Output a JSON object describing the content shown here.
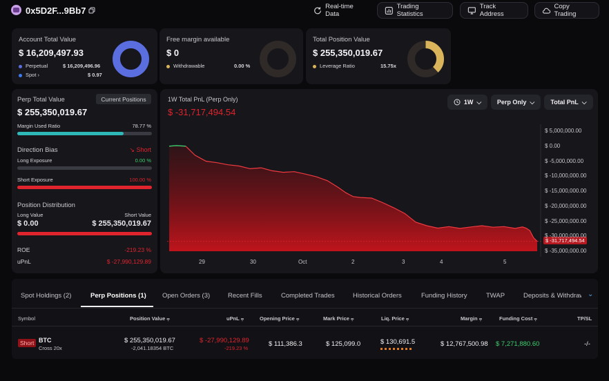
{
  "header": {
    "address": "0x5D2F...9Bb7",
    "buttons": [
      "Real-time Data",
      "Trading Statistics",
      "Track Address",
      "Copy Trading"
    ]
  },
  "account": {
    "title": "Account Total Value",
    "value": "$ 16,209,497.93",
    "perpetual_label": "Perpetual",
    "perpetual_value": "$ 16,209,496.96",
    "spot_label": "Spot",
    "spot_value": "$ 0.97",
    "donut_perp_fraction": 0.9999
  },
  "margin": {
    "title": "Free margin available",
    "value": "$ 0",
    "withdrawable_label": "Withdrawable",
    "withdrawable_value": "0.00 %"
  },
  "position": {
    "title": "Total Position Value",
    "value": "$ 255,350,019.67",
    "leverage_label": "Leverage Ratio",
    "leverage_value": "15.75x",
    "donut_fraction": 0.38
  },
  "perp": {
    "title": "Perp Total Value",
    "current_positions_label": "Current Positions",
    "value": "$ 255,350,019.67",
    "margin_used_label": "Margin Used Ratio",
    "margin_used_value": "78.77 %",
    "margin_used_fraction": 0.7877,
    "direction_bias_label": "Direction Bias",
    "direction_bias_value": "Short",
    "long_exposure_label": "Long Exposure",
    "long_exposure_value": "0.00 %",
    "long_exposure_fraction": 0,
    "short_exposure_label": "Short Exposure",
    "short_exposure_value": "100.00 %",
    "short_exposure_fraction": 1,
    "distribution_label": "Position Distribution",
    "long_value_label": "Long Value",
    "short_value_label": "Short Value",
    "long_value": "$ 0.00",
    "short_value": "$ 255,350,019.67",
    "roe_label": "ROE",
    "roe_value": "-219.23 %",
    "upnl_label": "uPnL",
    "upnl_value": "$ -27,990,129.89"
  },
  "pnl_chart_card": {
    "title": "1W Total PnL (Perp Only)",
    "value": "$ -31,717,494.54",
    "controls": [
      "1W",
      "Perp Only",
      "Total PnL"
    ]
  },
  "chart_data": {
    "type": "area",
    "title": "1W Total PnL (Perp Only)",
    "x_ticks": [
      "29",
      "30",
      "Oct",
      "2",
      "3",
      "4",
      "5"
    ],
    "y_ticks": [
      "$ 5,000,000.00",
      "$ 0.00",
      "$ -5,000,000.00",
      "$ -10,000,000.00",
      "$ -15,000,000.00",
      "$ -20,000,000.00",
      "$ -25,000,000.00",
      "$ -30,000,000.00",
      "$ -35,000,000.00"
    ],
    "ylim": [
      -35000000,
      5000000
    ],
    "last_value_label": "$ -31,717,494.54",
    "last_value": -31717494.54,
    "x": [
      0,
      0.02,
      0.045,
      0.07,
      0.085,
      0.1,
      0.13,
      0.16,
      0.19,
      0.22,
      0.25,
      0.28,
      0.31,
      0.34,
      0.37,
      0.4,
      0.43,
      0.46,
      0.48,
      0.5,
      0.52,
      0.55,
      0.58,
      0.61,
      0.64,
      0.67,
      0.7,
      0.73,
      0.76,
      0.79,
      0.82,
      0.85,
      0.88,
      0.91,
      0.94,
      0.96,
      0.97,
      0.98,
      0.99,
      1
    ],
    "values": [
      0,
      200000,
      0,
      -3000000,
      -4000000,
      -5000000,
      -5500000,
      -6200000,
      -6600000,
      -7500000,
      -7200000,
      -8200000,
      -8700000,
      -8500000,
      -9300000,
      -10200000,
      -11500000,
      -13800000,
      -15500000,
      -16800000,
      -17100000,
      -17300000,
      -18800000,
      -20500000,
      -22400000,
      -25300000,
      -26500000,
      -27300000,
      -26800000,
      -27400000,
      -26900000,
      -26500000,
      -27000000,
      -26800000,
      -27400000,
      -26900000,
      -27300000,
      -28100000,
      -30500000,
      -31717494.54
    ],
    "grid": false
  },
  "tabs": [
    "Spot Holdings (2)",
    "Perp Positions (1)",
    "Open Orders (3)",
    "Recent Fills",
    "Completed Trades",
    "Historical Orders",
    "Funding History",
    "TWAP",
    "Deposits & Withdraw"
  ],
  "table": {
    "headers": [
      "Symbol",
      "Position Value",
      "uPnL",
      "Opening Price",
      "Mark Price",
      "Liq. Price",
      "Margin",
      "Funding Cost",
      "TP/SL"
    ],
    "row": {
      "side": "Short",
      "coin": "BTC",
      "mode": "Cross 20x",
      "position_value": "$ 255,350,019.67",
      "position_size": "-2,041.18354 BTC",
      "upnl": "$ -27,990,129.89",
      "upnl_pct": "-219.23 %",
      "opening_price": "$ 111,386.3",
      "mark_price": "$ 125,099.0",
      "liq_price": "$ 130,691.5",
      "margin": "$ 12,767,500.98",
      "funding_cost": "$ 7,271,880.60",
      "tpsl": "-/-"
    }
  },
  "colors": {
    "perp_blue": "#5b6ee0",
    "spot_blue": "#3d7cf0",
    "gold": "#d9b45a",
    "teal": "#2fb8b8",
    "red": "#e0242e",
    "green": "#3ccf6e"
  }
}
